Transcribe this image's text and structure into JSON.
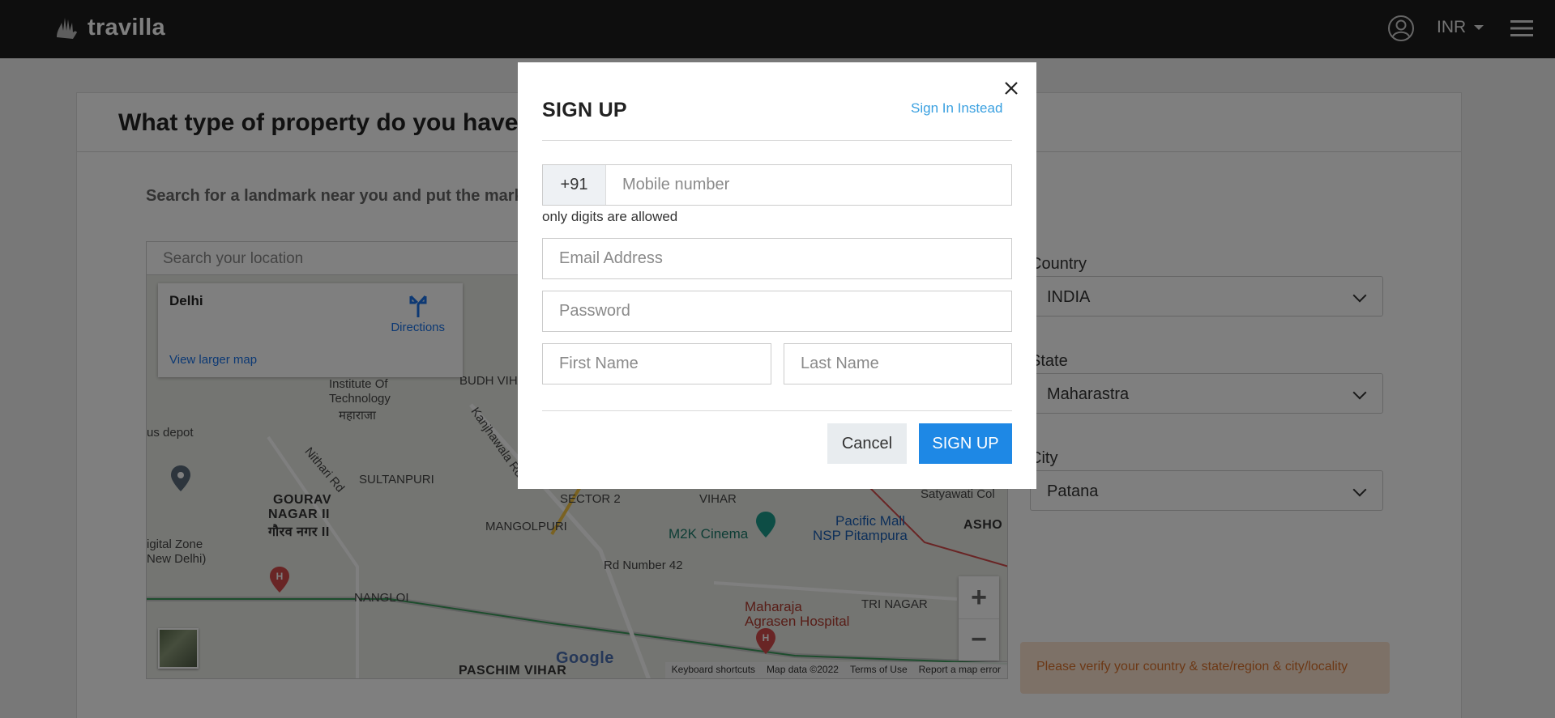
{
  "nav": {
    "brand": "travilla",
    "currency": "INR"
  },
  "page": {
    "title": "What type of property do you have?",
    "hint": "Search for a landmark near you and put the mark",
    "search_placeholder": "Search your location"
  },
  "map": {
    "info": {
      "place": "Delhi",
      "directions": "Directions",
      "larger_map": "View larger map"
    },
    "labels": {
      "institute1": "Institute Of",
      "institute2": "Technology",
      "institute_hi": "महाराजा",
      "depot": "us depot",
      "digital1": "igital Zone",
      "digital2": "New Delhi)",
      "gourav1": "GOURAV",
      "gourav2": "NAGAR II",
      "gourav_hi": "गौरव नगर II",
      "sultanpuri": "SULTANPURI",
      "mangolpuri": "MANGOLPURI",
      "nangloi": "NANGLOI",
      "budh_vihar": "BUDH VIHAR",
      "m2k": "M2K Cinema",
      "pacific1": "Pacific Mall",
      "pacific2": "NSP Pitampura",
      "maharaja1": "Maharaja",
      "maharaja2": "Agrasen Hospital",
      "paschim": "PASCHIM VIHAR",
      "rd42": "Rd Number 42",
      "tri_nagar": "TRI NAGAR",
      "vihar": "VIHAR",
      "satyawati": "Satyawati Col",
      "asho": "ASHO",
      "sector2": "SECTOR 2",
      "kanjhawala": "Kanjhawala Rd",
      "nithari": "Nithari Rd"
    },
    "google": "Google",
    "footer": {
      "shortcuts": "Keyboard shortcuts",
      "mapdata": "Map data ©2022",
      "terms": "Terms of Use",
      "report": "Report a map error"
    }
  },
  "form": {
    "country_label": "Country",
    "country_value": "INDIA",
    "state_label": "State",
    "state_value": "Maharastra",
    "city_label": "City",
    "city_value": "Patana",
    "warning": "Please verify your country & state/region & city/locality"
  },
  "modal": {
    "title": "SIGN UP",
    "signin_link": "Sign In Instead",
    "phone_prefix": "+91",
    "phone_placeholder": "Mobile number",
    "phone_help": "only digits are allowed",
    "email_placeholder": "Email Address",
    "password_placeholder": "Password",
    "first_name_placeholder": "First Name",
    "last_name_placeholder": "Last Name",
    "cancel_label": "Cancel",
    "signup_label": "SIGN UP"
  },
  "colors": {
    "topbar": "#1c1c1c",
    "primary": "#1e88e5",
    "link": "#3aa0e0",
    "warning_bg": "#fbe3cf",
    "warning_text": "#d8702a"
  }
}
